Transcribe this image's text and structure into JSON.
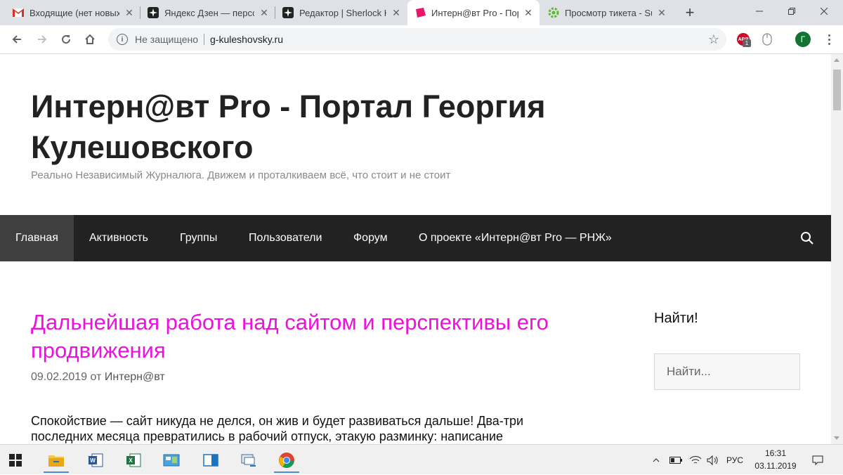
{
  "browser": {
    "tabs": [
      {
        "label": "Входящие (нет новых) - ",
        "icon": "gmail-icon",
        "active": false
      },
      {
        "label": "Яндекс Дзен — персональная лента",
        "icon": "zen-icon",
        "active": false
      },
      {
        "label": "Редактор | Sherlock Holmes",
        "icon": "zen-icon",
        "active": false
      },
      {
        "label": "Интерн@вт Pro - Портал",
        "icon": "site-icon",
        "active": true
      },
      {
        "label": "Просмотр тикета - Sup",
        "icon": "gear-icon",
        "active": false
      }
    ],
    "address": {
      "security_label": "Не защищено",
      "url": "g-kuleshovsky.ru"
    },
    "extensions": {
      "adblock_label": "ABP",
      "adblock_count": "1"
    },
    "profile_initial": "Г"
  },
  "site": {
    "title": "Интерн@вт Pro - Портал Георгия Кулешовского",
    "tagline": "Реально Независимый Журналюга. Движем и проталкиваем всё, что стоит и не стоит",
    "nav": [
      {
        "label": "Главная",
        "active": true
      },
      {
        "label": "Активность",
        "active": false
      },
      {
        "label": "Группы",
        "active": false
      },
      {
        "label": "Пользователи",
        "active": false
      },
      {
        "label": "Форум",
        "active": false
      },
      {
        "label": "О проекте «Интерн@вт Pro — РНЖ»",
        "active": false
      }
    ],
    "post": {
      "title": "Дальнейшая работа над сайтом и перспективы его продвижения",
      "date": "09.02.2019",
      "by": "от",
      "author": "Интерн@вт",
      "body": "Спокойствие — сайт никуда не делся, он жив и будет развиваться дальше! Два-три последних месяца превратились в рабочий отпуск, этакую разминку: написание"
    },
    "sidebar": {
      "widget_title": "Найти!",
      "search_placeholder": "Найти..."
    },
    "colors": {
      "post_title": "#ee11dd",
      "nav_bg": "#222222",
      "nav_active_bg": "#3f3f3f"
    }
  },
  "taskbar": {
    "apps": [
      "file-explorer-icon",
      "word-icon",
      "excel-icon",
      "control-panel-icon",
      "window-icon",
      "network-icon",
      "chrome-icon"
    ],
    "language": "РУС",
    "time": "16:31",
    "date": "03.11.2019"
  }
}
